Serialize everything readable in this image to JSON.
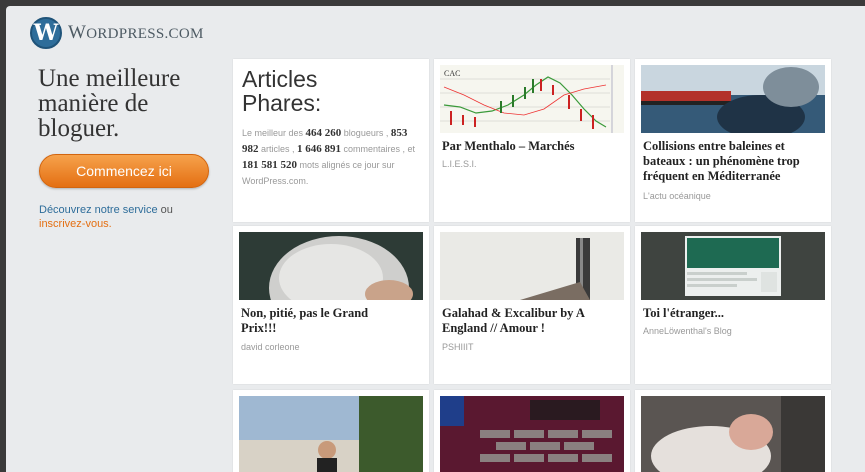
{
  "header": {
    "logo_text_big": "W",
    "logo_text_rest": "ORDPRESS",
    "logo_text_suffix": ".COM"
  },
  "left": {
    "tagline": "Une meilleure manière de bloguer.",
    "cta_label": "Commencez ici",
    "discover_link": "Découvrez notre service",
    "discover_or": " ou ",
    "signup_link": "inscrivez-vous."
  },
  "intro": {
    "title": "Articles Phares:",
    "t1": "Le meilleur des ",
    "n1": "464 260",
    "t2": " blogueurs ,",
    "n2": "853 982",
    "t3": " articles , ",
    "n3": "1 646 891",
    "t4": " commentaires , et ",
    "n4": "181 581 520",
    "t5": " mots alignés ce jour sur WordPress.com."
  },
  "cards": [
    {
      "title": "Par Menthalo – Marchés",
      "source": "L.I.E.S.I.",
      "thumb_label": "CAC"
    },
    {
      "title": "Collisions entre baleines et bateaux : un phénomène trop fréquent en Méditerranée",
      "source": "L'actu océanique"
    },
    {
      "title": "Non, pitié, pas le Grand Prix!!!",
      "source": "david corleone"
    },
    {
      "title": "Galahad & Excalibur by A England // Amour !",
      "source": "PSHIIIT"
    },
    {
      "title": "Toi l'étranger...",
      "source": "AnneLöwenthal's Blog"
    }
  ],
  "colors": {
    "accent_orange": "#e46f12",
    "link_blue": "#2e6d9a",
    "page_bg": "#e9ebed"
  }
}
